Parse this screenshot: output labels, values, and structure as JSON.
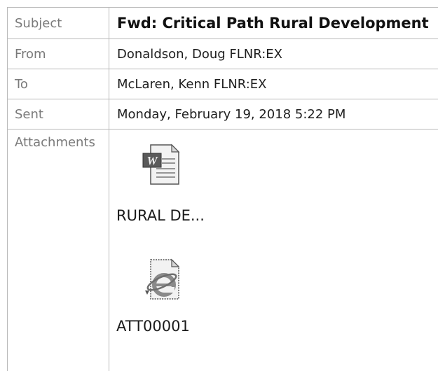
{
  "header": {
    "subject_label": "Subject",
    "subject_value": "Fwd: Critical Path Rural Development",
    "from_label": "From",
    "from_value": "Donaldson, Doug FLNR:EX",
    "to_label": "To",
    "to_value": "McLaren, Kenn FLNR:EX",
    "sent_label": "Sent",
    "sent_value": "Monday, February 19, 2018 5:22 PM",
    "attachments_label": "Attachments"
  },
  "attachments": [
    {
      "name": "RURAL DE...",
      "icon": "word-document-icon"
    },
    {
      "name": "ATT00001",
      "icon": "internet-explorer-document-icon"
    }
  ]
}
